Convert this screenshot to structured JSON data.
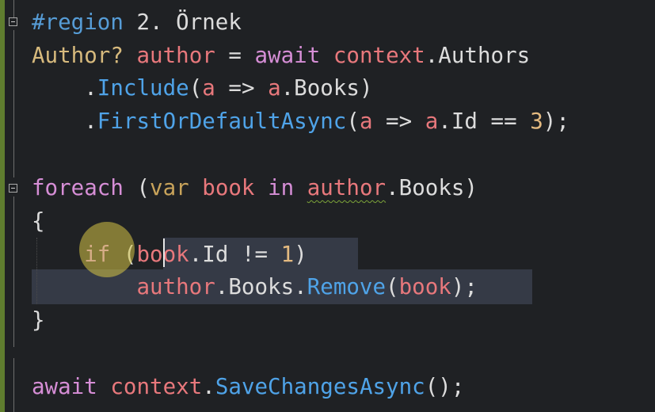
{
  "editor": {
    "lines": [
      {
        "id": "region-start",
        "tokens": [
          {
            "t": "#region",
            "c": "region"
          },
          {
            "t": " 2. Örnek",
            "c": "plain"
          }
        ]
      },
      {
        "id": "author-decl",
        "tokens": [
          {
            "t": "Author?",
            "c": "type"
          },
          {
            "t": " ",
            "c": "plain"
          },
          {
            "t": "author",
            "c": "var"
          },
          {
            "t": " = ",
            "c": "plain"
          },
          {
            "t": "await",
            "c": "k"
          },
          {
            "t": " ",
            "c": "plain"
          },
          {
            "t": "context",
            "c": "var"
          },
          {
            "t": ".Authors",
            "c": "plain"
          }
        ]
      },
      {
        "id": "include-call",
        "tokens": [
          {
            "t": "    .",
            "c": "plain"
          },
          {
            "t": "Include",
            "c": "meth"
          },
          {
            "t": "(",
            "c": "plain"
          },
          {
            "t": "a",
            "c": "var"
          },
          {
            "t": " => ",
            "c": "plain"
          },
          {
            "t": "a",
            "c": "var"
          },
          {
            "t": ".Books)",
            "c": "plain"
          }
        ]
      },
      {
        "id": "first-call",
        "tokens": [
          {
            "t": "    .",
            "c": "plain"
          },
          {
            "t": "FirstOrDefaultAsync",
            "c": "meth"
          },
          {
            "t": "(",
            "c": "plain"
          },
          {
            "t": "a",
            "c": "var"
          },
          {
            "t": " => ",
            "c": "plain"
          },
          {
            "t": "a",
            "c": "var"
          },
          {
            "t": ".Id == ",
            "c": "plain"
          },
          {
            "t": "3",
            "c": "num"
          },
          {
            "t": ");",
            "c": "plain"
          }
        ]
      },
      {
        "id": "blank-1",
        "tokens": []
      },
      {
        "id": "foreach-line",
        "tokens": [
          {
            "t": "foreach",
            "c": "k"
          },
          {
            "t": " (",
            "c": "plain"
          },
          {
            "t": "var",
            "c": "kw2"
          },
          {
            "t": " ",
            "c": "plain"
          },
          {
            "t": "book",
            "c": "var"
          },
          {
            "t": " ",
            "c": "plain"
          },
          {
            "t": "in",
            "c": "k"
          },
          {
            "t": " ",
            "c": "plain"
          },
          {
            "t": "author",
            "c": "var squiggle"
          },
          {
            "t": ".Books)",
            "c": "plain"
          }
        ]
      },
      {
        "id": "open-brace",
        "tokens": [
          {
            "t": "{",
            "c": "plain"
          }
        ]
      },
      {
        "id": "if-line",
        "tokens": [
          {
            "t": "    ",
            "c": "plain"
          },
          {
            "t": "if",
            "c": "k"
          },
          {
            "t": " (",
            "c": "plain"
          },
          {
            "t": "book",
            "c": "var"
          },
          {
            "t": ".Id != ",
            "c": "plain"
          },
          {
            "t": "1",
            "c": "num"
          },
          {
            "t": ")",
            "c": "plain"
          }
        ]
      },
      {
        "id": "remove-line",
        "tokens": [
          {
            "t": "        ",
            "c": "plain"
          },
          {
            "t": "author",
            "c": "var"
          },
          {
            "t": ".Books.",
            "c": "plain"
          },
          {
            "t": "Remove",
            "c": "meth"
          },
          {
            "t": "(",
            "c": "plain"
          },
          {
            "t": "book",
            "c": "var"
          },
          {
            "t": ");",
            "c": "plain"
          }
        ]
      },
      {
        "id": "close-brace",
        "tokens": [
          {
            "t": "}",
            "c": "plain"
          }
        ]
      },
      {
        "id": "blank-2",
        "tokens": []
      },
      {
        "id": "save-line",
        "tokens": [
          {
            "t": "await",
            "c": "k"
          },
          {
            "t": " ",
            "c": "plain"
          },
          {
            "t": "context",
            "c": "var"
          },
          {
            "t": ".",
            "c": "plain"
          },
          {
            "t": "SaveChangesAsync",
            "c": "meth"
          },
          {
            "t": "();",
            "c": "plain"
          }
        ]
      }
    ]
  },
  "colors": {
    "background": "#1f2124",
    "change_bar": "#5f7d2f",
    "selection": "#353a46",
    "keyword": "#d68ed6",
    "region": "#569cd6",
    "type": "#d7ba7d",
    "variable": "#e8787c",
    "method": "#4fa3e8",
    "number": "#e4ba80",
    "squiggle": "#7ea639",
    "cursor_halo": "#d6c446"
  }
}
